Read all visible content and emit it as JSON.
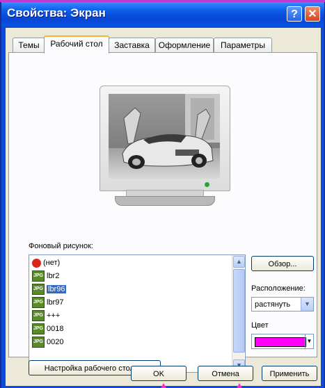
{
  "window": {
    "title": "Свойства: Экран",
    "help_glyph": "?",
    "close_glyph": "✕"
  },
  "tabs": [
    {
      "label": "Темы"
    },
    {
      "label": "Рабочий стол",
      "active": true
    },
    {
      "label": "Заставка"
    },
    {
      "label": "Оформление"
    },
    {
      "label": "Параметры"
    }
  ],
  "wallpaper": {
    "label": "Фоновый рисунок:",
    "items": [
      {
        "label": "(нет)",
        "icon": "none-icon",
        "badge": ""
      },
      {
        "label": "lbr2",
        "icon": "jpg-icon",
        "badge": "JPG"
      },
      {
        "label": "lbr96",
        "icon": "jpg-icon",
        "badge": "JPG",
        "selected": true
      },
      {
        "label": "lbr97",
        "icon": "jpg-icon",
        "badge": "JPG"
      },
      {
        "label": "+++",
        "icon": "jpg-icon",
        "badge": "JPG"
      },
      {
        "label": "0018",
        "icon": "jpg-icon",
        "badge": "JPG"
      },
      {
        "label": "0020",
        "icon": "jpg-icon",
        "badge": "JPG"
      }
    ],
    "browse_label": "Обзор...",
    "position_label": "Расположение:",
    "position_value": "растянуть",
    "color_label": "Цвет",
    "color_value": "#ff00ff"
  },
  "customize_label": "Настройка рабочего стола...",
  "buttons": {
    "ok": "OK",
    "cancel": "Отмена",
    "apply": "Применить"
  },
  "colors": {
    "title_bar": "#0a52e0",
    "accent_tab": "#f7b13a",
    "selection": "#316ac5",
    "desktop_color": "#ff00ff"
  }
}
